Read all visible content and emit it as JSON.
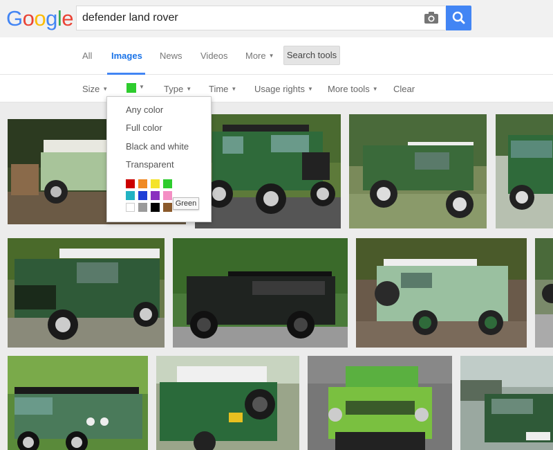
{
  "search": {
    "query": "defender land rover"
  },
  "logo": [
    "G",
    "o",
    "o",
    "g",
    "l",
    "e"
  ],
  "logo_colors": [
    "#4285f4",
    "#ea4335",
    "#fbbc05",
    "#4285f4",
    "#34a853",
    "#ea4335"
  ],
  "tabs": [
    {
      "label": "All",
      "active": false
    },
    {
      "label": "Images",
      "active": true
    },
    {
      "label": "News",
      "active": false
    },
    {
      "label": "Videos",
      "active": false
    },
    {
      "label": "More",
      "active": false
    }
  ],
  "search_tools_label": "Search tools",
  "tools": {
    "size": "Size",
    "type": "Type",
    "time": "Time",
    "usage_rights": "Usage rights",
    "more_tools": "More tools",
    "clear": "Clear",
    "selected_color": "#2ecc2e"
  },
  "color_menu": {
    "options": [
      "Any color",
      "Full color",
      "Black and white",
      "Transparent"
    ],
    "swatches": [
      "#cc0000",
      "#f08a24",
      "#f4e32a",
      "#2ecc2e",
      "#22b3c3",
      "#1f3fd6",
      "#8a2fbf",
      "#f48fc4",
      "#ffffff",
      "#9a9a9a",
      "#000000",
      "#8b5a2b"
    ],
    "tooltip": "Green"
  },
  "colors": {
    "accent": "#4285f4",
    "active_tab": "#1a73e8"
  }
}
